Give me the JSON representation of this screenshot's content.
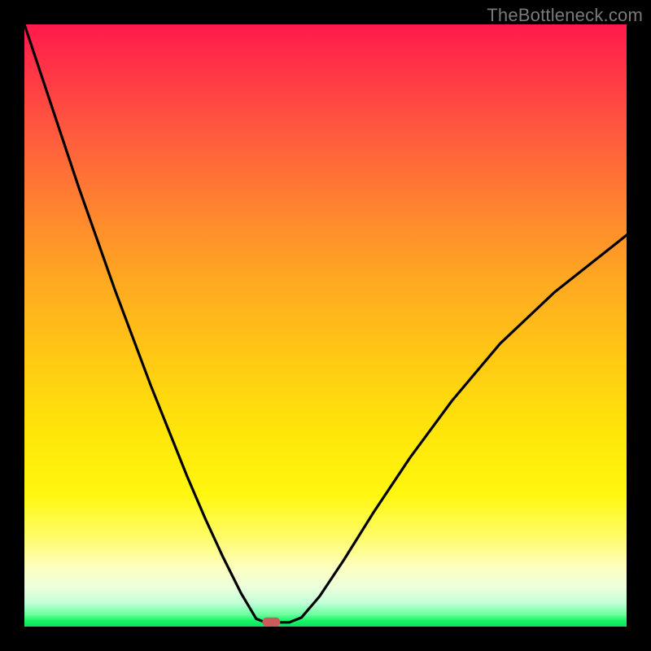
{
  "watermark": "TheBottleneck.com",
  "chart_data": {
    "type": "line",
    "title": "",
    "xlabel": "",
    "ylabel": "",
    "xlim": [
      0,
      100
    ],
    "ylim": [
      0,
      100
    ],
    "grid": false,
    "background": "rainbow-vertical-gradient",
    "series": [
      {
        "name": "curve",
        "color": "#000000",
        "x": [
          0,
          3,
          6,
          9,
          12,
          15,
          18,
          21,
          24,
          27,
          30,
          33,
          36,
          38.5,
          40,
          41.5,
          44,
          46,
          49,
          53,
          58,
          64,
          71,
          79,
          88,
          100
        ],
        "y": [
          100,
          91,
          82,
          73,
          64.5,
          56,
          48,
          40,
          32.5,
          25,
          18,
          11.5,
          5.5,
          1.3,
          0.7,
          0.7,
          0.7,
          1.5,
          5,
          11,
          19,
          28,
          37.5,
          47,
          55.5,
          65
        ]
      }
    ],
    "marker": {
      "name": "min-point",
      "x": 41,
      "y": 0.7,
      "color": "#cc5a5a",
      "shape": "rounded-rect"
    }
  }
}
